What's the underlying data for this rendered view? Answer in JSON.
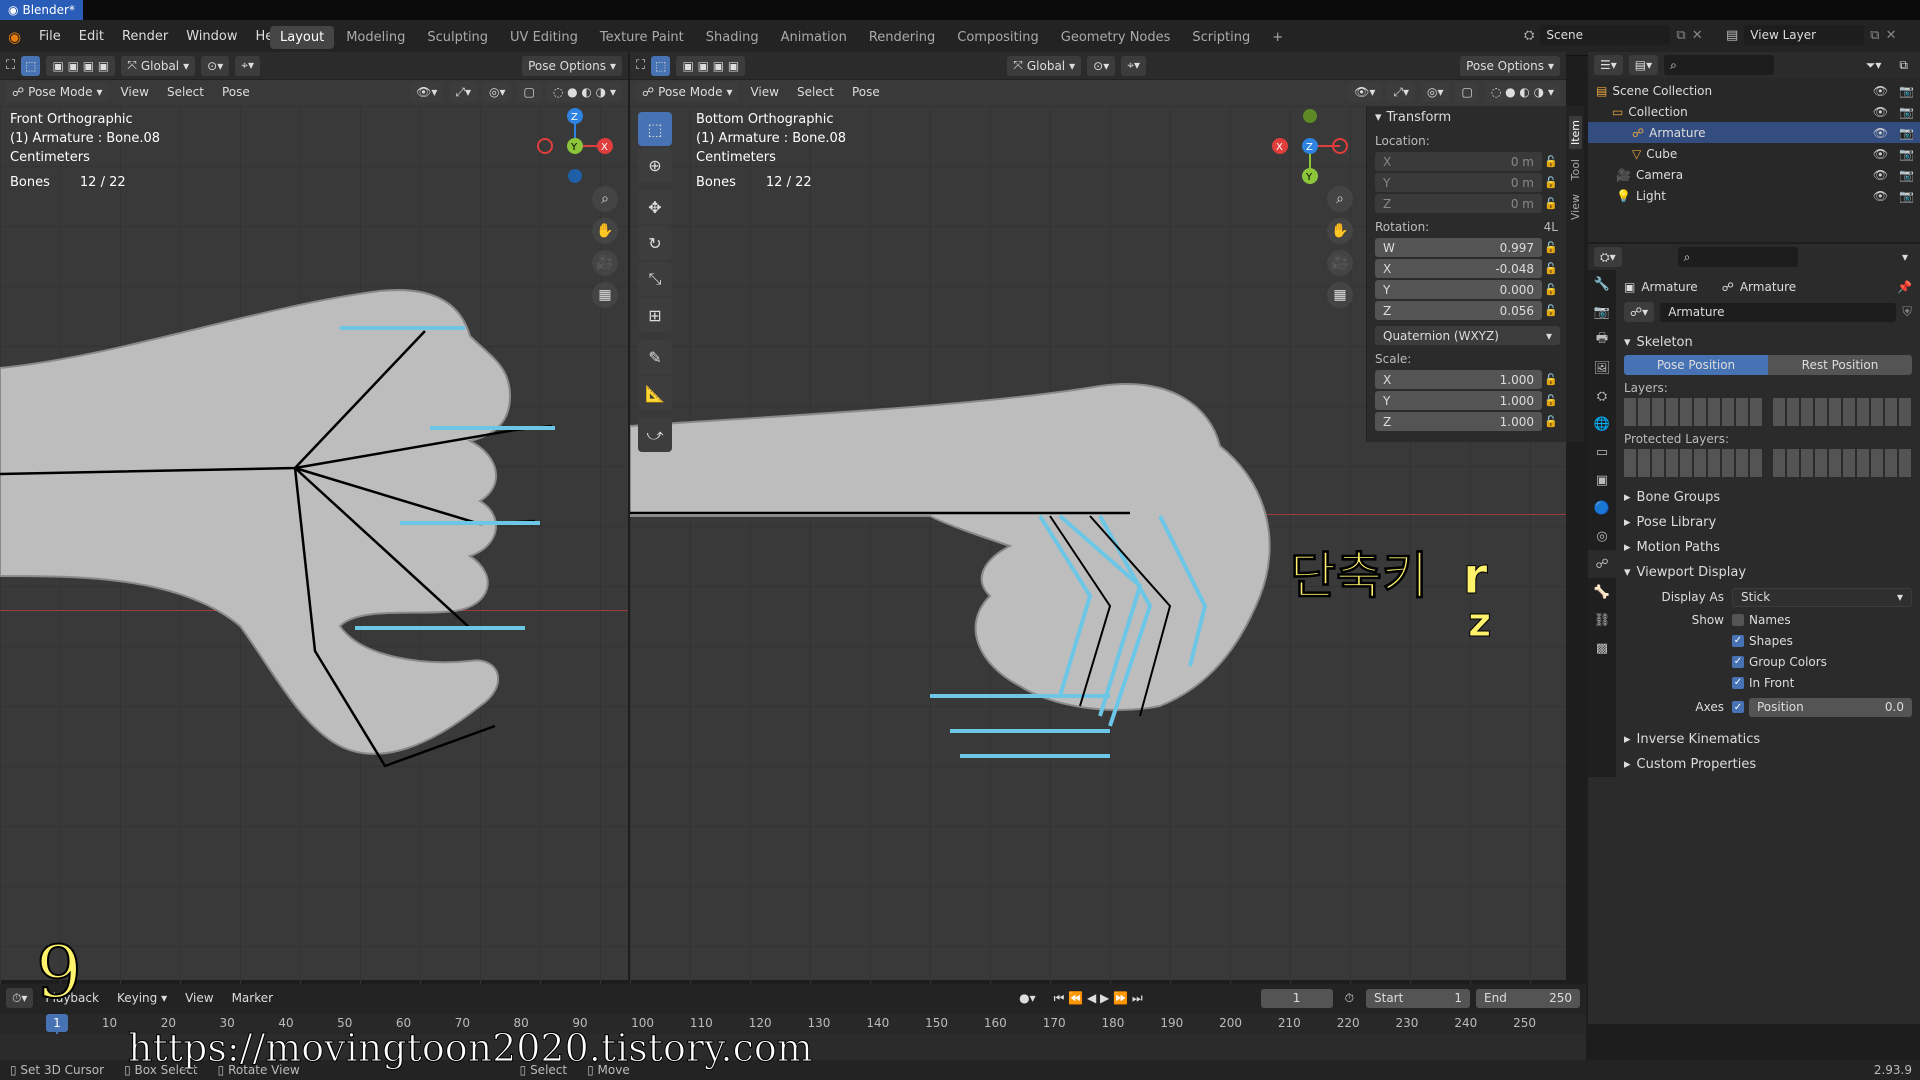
{
  "window": {
    "title": "Blender*"
  },
  "menu": [
    "File",
    "Edit",
    "Render",
    "Window",
    "Help"
  ],
  "workspaces": [
    "Layout",
    "Modeling",
    "Sculpting",
    "UV Editing",
    "Texture Paint",
    "Shading",
    "Animation",
    "Rendering",
    "Compositing",
    "Geometry Nodes",
    "Scripting",
    "+"
  ],
  "scene": {
    "label": "Scene",
    "view_layer": "View Layer"
  },
  "left_view": {
    "transform": "Global",
    "pose_options": "Pose Options",
    "mode": "Pose Mode",
    "menus": [
      "View",
      "Select",
      "Pose"
    ],
    "overlay_lines": [
      "Front Orthographic",
      "(1) Armature : Bone.08",
      "Centimeters"
    ],
    "bones_label": "Bones",
    "bones_count": "12 / 22"
  },
  "right_view": {
    "transform": "Global",
    "pose_options": "Pose Options",
    "mode": "Pose Mode",
    "menus": [
      "View",
      "Select",
      "Pose"
    ],
    "overlay_lines": [
      "Bottom Orthographic",
      "(1) Armature : Bone.08",
      "Centimeters"
    ],
    "bones_label": "Bones",
    "bones_count": "12 / 22",
    "annotation_line1": "단축키  r",
    "annotation_line2": "z"
  },
  "npanel": {
    "header": "Transform",
    "tabs": [
      "Item",
      "Tool",
      "View"
    ],
    "location_label": "Location:",
    "location": [
      {
        "axis": "X",
        "value": "0 m"
      },
      {
        "axis": "Y",
        "value": "0 m"
      },
      {
        "axis": "Z",
        "value": "0 m"
      }
    ],
    "rotation_label": "Rotation:",
    "rotation_mode_badge": "4L",
    "rotation": [
      {
        "axis": "W",
        "value": "0.997"
      },
      {
        "axis": "X",
        "value": "-0.048"
      },
      {
        "axis": "Y",
        "value": "0.000"
      },
      {
        "axis": "Z",
        "value": "0.056"
      }
    ],
    "rotation_mode": "Quaternion (WXYZ)",
    "scale_label": "Scale:",
    "scale": [
      {
        "axis": "X",
        "value": "1.000"
      },
      {
        "axis": "Y",
        "value": "1.000"
      },
      {
        "axis": "Z",
        "value": "1.000"
      }
    ]
  },
  "outliner": {
    "rows": [
      {
        "name": "Scene Collection",
        "sel": false
      },
      {
        "name": "Collection",
        "sel": false
      },
      {
        "name": "Armature",
        "sel": true
      },
      {
        "name": "Cube",
        "sel": false
      },
      {
        "name": "Camera",
        "sel": false
      },
      {
        "name": "Light",
        "sel": false
      }
    ]
  },
  "properties": {
    "breadcrumb_obj": "Armature",
    "breadcrumb_data": "Armature",
    "data_name": "Armature",
    "skeleton": "Skeleton",
    "pose_position": "Pose Position",
    "rest_position": "Rest Position",
    "layers": "Layers:",
    "protected_layers": "Protected Layers:",
    "sections": [
      "Bone Groups",
      "Pose Library",
      "Motion Paths"
    ],
    "viewport_display": "Viewport Display",
    "display_as_label": "Display As",
    "display_as": "Stick",
    "show_label": "Show",
    "show_items": [
      {
        "label": "Names",
        "checked": false
      },
      {
        "label": "Shapes",
        "checked": true
      },
      {
        "label": "Group Colors",
        "checked": true
      },
      {
        "label": "In Front",
        "checked": true
      }
    ],
    "axes_label": "Axes",
    "axes_position": "Position",
    "axes_value": "0.0",
    "ik": "Inverse Kinematics",
    "custom": "Custom Properties"
  },
  "timeline": {
    "menus": [
      "Playback",
      "Keying",
      "View",
      "Marker"
    ],
    "current": "1",
    "start_label": "Start",
    "start": "1",
    "end_label": "End",
    "end": "250",
    "ruler": [
      "1",
      "10",
      "20",
      "30",
      "40",
      "50",
      "60",
      "70",
      "80",
      "90",
      "100",
      "110",
      "120",
      "130",
      "140",
      "150",
      "160",
      "170",
      "180",
      "190",
      "200",
      "210",
      "220",
      "230",
      "240",
      "250"
    ]
  },
  "status": {
    "items": [
      "Set 3D Cursor",
      "Box Select",
      "Rotate View",
      "Select",
      "Move"
    ],
    "version": "2.93.9"
  },
  "overlay": {
    "step_number": "9",
    "watermark": "https://movingtoon2020.tistory.com"
  }
}
